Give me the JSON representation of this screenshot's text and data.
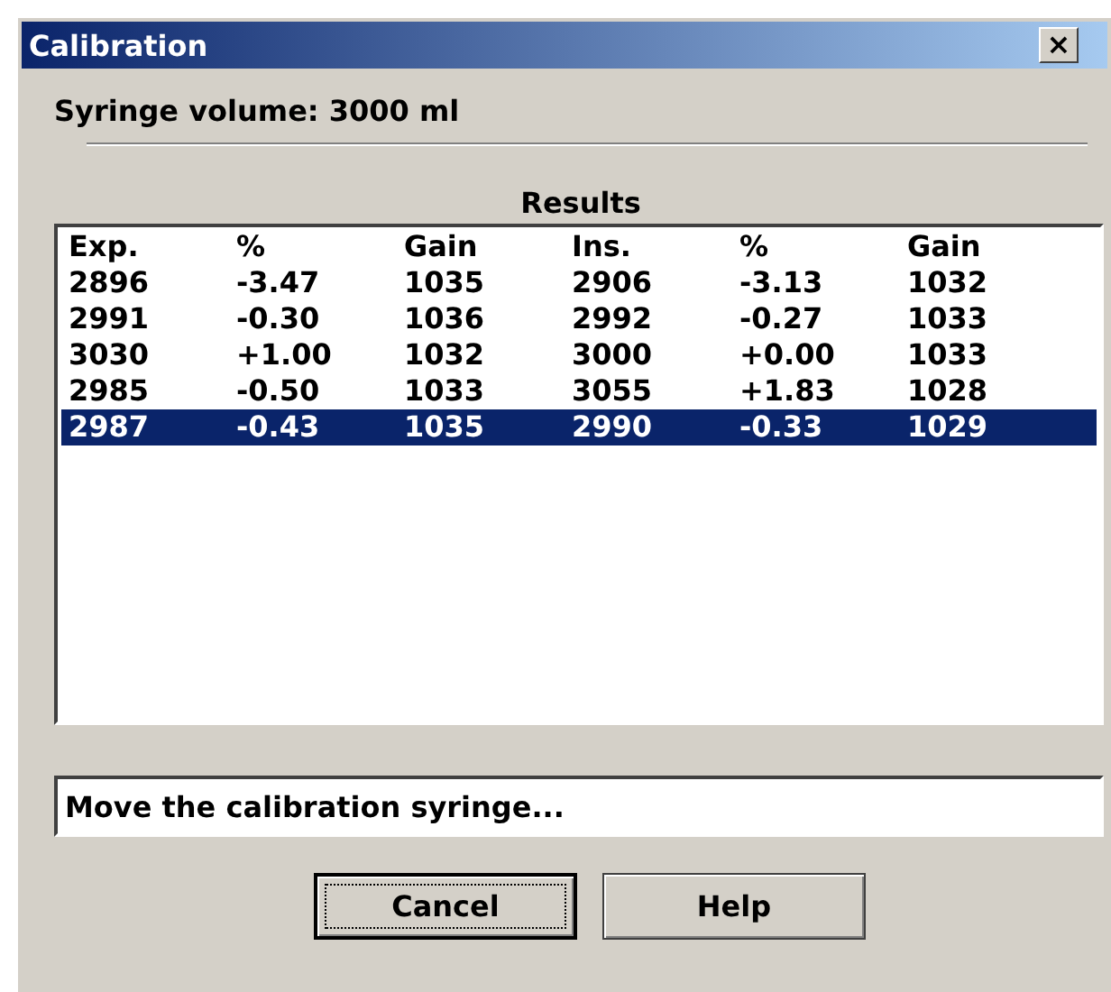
{
  "window": {
    "title": "Calibration",
    "close": "×"
  },
  "syringe_volume": "Syringe volume: 3000 ml",
  "results": {
    "title": "Results",
    "columns": [
      "Exp.",
      "%",
      "Gain",
      "Ins.",
      "%",
      "Gain"
    ],
    "rows": [
      {
        "cells": [
          "2896",
          "-3.47",
          "1035",
          "2906",
          "-3.13",
          "1032"
        ],
        "selected": false
      },
      {
        "cells": [
          "2991",
          "-0.30",
          "1036",
          "2992",
          "-0.27",
          "1033"
        ],
        "selected": false
      },
      {
        "cells": [
          "3030",
          "+1.00",
          "1032",
          "3000",
          "+0.00",
          "1033"
        ],
        "selected": false
      },
      {
        "cells": [
          "2985",
          "-0.50",
          "1033",
          "3055",
          "+1.83",
          "1028"
        ],
        "selected": false
      },
      {
        "cells": [
          "2987",
          "-0.43",
          "1035",
          "2990",
          "-0.33",
          "1029"
        ],
        "selected": true
      }
    ]
  },
  "status": "Move the calibration syringe...",
  "buttons": [
    {
      "label": "Cancel",
      "focused": true
    },
    {
      "label": "Help",
      "focused": false
    }
  ]
}
